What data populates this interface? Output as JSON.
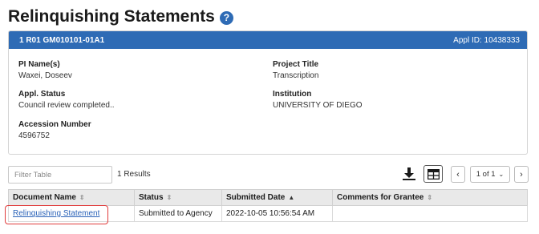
{
  "page": {
    "title": "Relinquishing Statements",
    "help_icon": "question-circle-icon"
  },
  "card": {
    "grant_number": "1 R01 GM010101-01A1",
    "appl_id": "Appl ID: 10438333",
    "header_color": "#2e6bb5",
    "fields": {
      "pi_label": "PI Name(s)",
      "pi_value": "Waxei, Doseev",
      "project_title_label": "Project Title",
      "project_title_value": "Transcription",
      "status_label": "Appl. Status",
      "status_value": "Council review completed..",
      "institution_label": "Institution",
      "institution_value": "UNIVERSITY OF DIEGO",
      "accession_label": "Accession Number",
      "accession_value": "4596752"
    }
  },
  "toolbar": {
    "filter_placeholder": "Filter Table",
    "results_text": "1 Results",
    "page_label": "1 of 1",
    "download_icon": "download-excel-icon",
    "grid_icon": "table-view-icon"
  },
  "table": {
    "columns": [
      {
        "label": "Document Name",
        "sort": "⇕"
      },
      {
        "label": "Status",
        "sort": "⇕"
      },
      {
        "label": "Submitted Date",
        "sort": "▲"
      },
      {
        "label": "Comments for Grantee",
        "sort": "⇕"
      }
    ],
    "rows": [
      [
        "Relinquishing Statement",
        "Submitted to Agency",
        "2022-10-05 10:56:54 AM",
        ""
      ]
    ]
  },
  "colors": {
    "accent": "#2e6bb5",
    "link": "#2a62b8",
    "highlight": "#e03c3c"
  }
}
